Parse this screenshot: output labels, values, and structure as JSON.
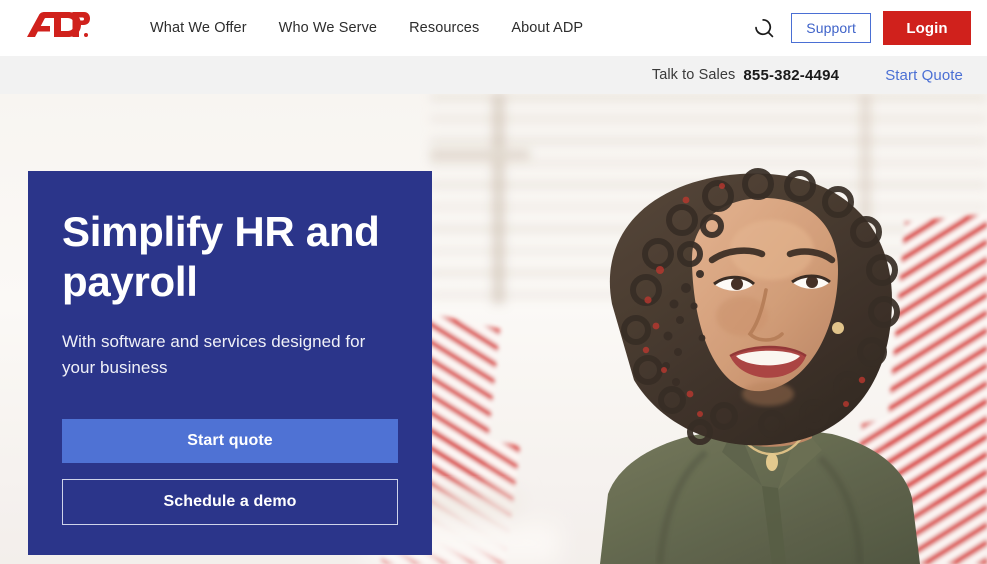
{
  "brand": {
    "logo_text": "ADP",
    "logo_name": "adp-logo",
    "red": "#d0211c",
    "navy": "#2b358a",
    "accent_blue": "#4f72d4",
    "link_blue": "#4a6fd4"
  },
  "topnav": {
    "links": [
      {
        "label": "What We Offer"
      },
      {
        "label": "Who We Serve"
      },
      {
        "label": "Resources"
      },
      {
        "label": "About ADP"
      }
    ],
    "search_icon": "search-icon",
    "support_label": "Support",
    "login_label": "Login"
  },
  "salesbar": {
    "talk_label": "Talk to Sales",
    "phone": "855-382-4494",
    "start_quote_label": "Start Quote"
  },
  "hero": {
    "title": "Simplify HR and payroll",
    "subtitle": "With software and services designed for your business",
    "primary_cta": "Start quote",
    "secondary_cta": "Schedule a demo",
    "background_description": "office-photo-smiling-woman"
  }
}
